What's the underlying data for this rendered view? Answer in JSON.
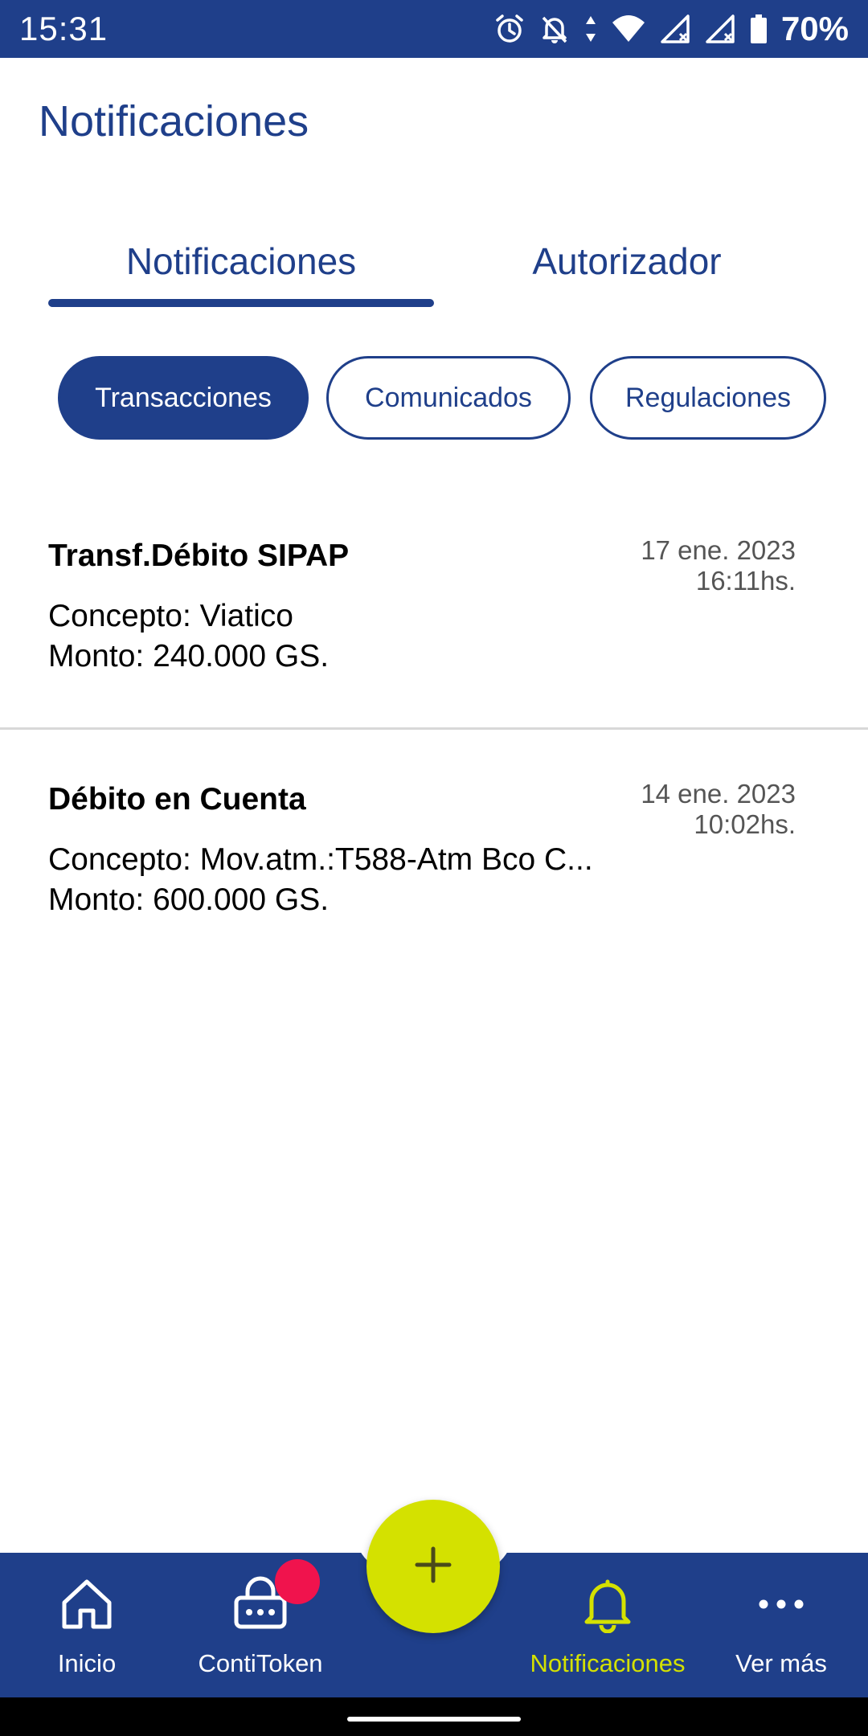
{
  "status_bar": {
    "time": "15:31",
    "battery": "70%",
    "icons": [
      "alarm-icon",
      "notifications-off-icon",
      "data-arrows-icon",
      "wifi-icon",
      "signal-icon",
      "signal-icon",
      "battery-icon"
    ]
  },
  "header": {
    "title": "Notificaciones"
  },
  "tabs": [
    {
      "label": "Notificaciones",
      "active": true
    },
    {
      "label": "Autorizador",
      "active": false
    }
  ],
  "filters": [
    {
      "label": "Transacciones",
      "active": true
    },
    {
      "label": "Comunicados",
      "active": false
    },
    {
      "label": "Regulaciones",
      "active": false
    }
  ],
  "notifications": [
    {
      "title": "Transf.Débito SIPAP",
      "date": "17  ene.  2023",
      "time": "16:11hs.",
      "concept": "Concepto: Viatico",
      "amount": "Monto:  240.000 GS."
    },
    {
      "title": "Débito en Cuenta",
      "date": "14  ene.  2023",
      "time": "10:02hs.",
      "concept": "Concepto: Mov.atm.:T588-Atm Bco C...",
      "amount": "Monto:  600.000 GS."
    }
  ],
  "bottom_nav": {
    "items": [
      {
        "label": "Inicio",
        "icon": "home-icon",
        "active": false
      },
      {
        "label": "ContiToken",
        "icon": "token-icon",
        "active": false
      },
      {
        "label": "Notificaciones",
        "icon": "bell-icon",
        "active": true
      },
      {
        "label": "Ver más",
        "icon": "more-icon",
        "active": false
      }
    ],
    "fab_icon": "plus-icon"
  },
  "colors": {
    "primary": "#1f3f8a",
    "accent": "#d4e100",
    "badge": "#f0134d"
  }
}
